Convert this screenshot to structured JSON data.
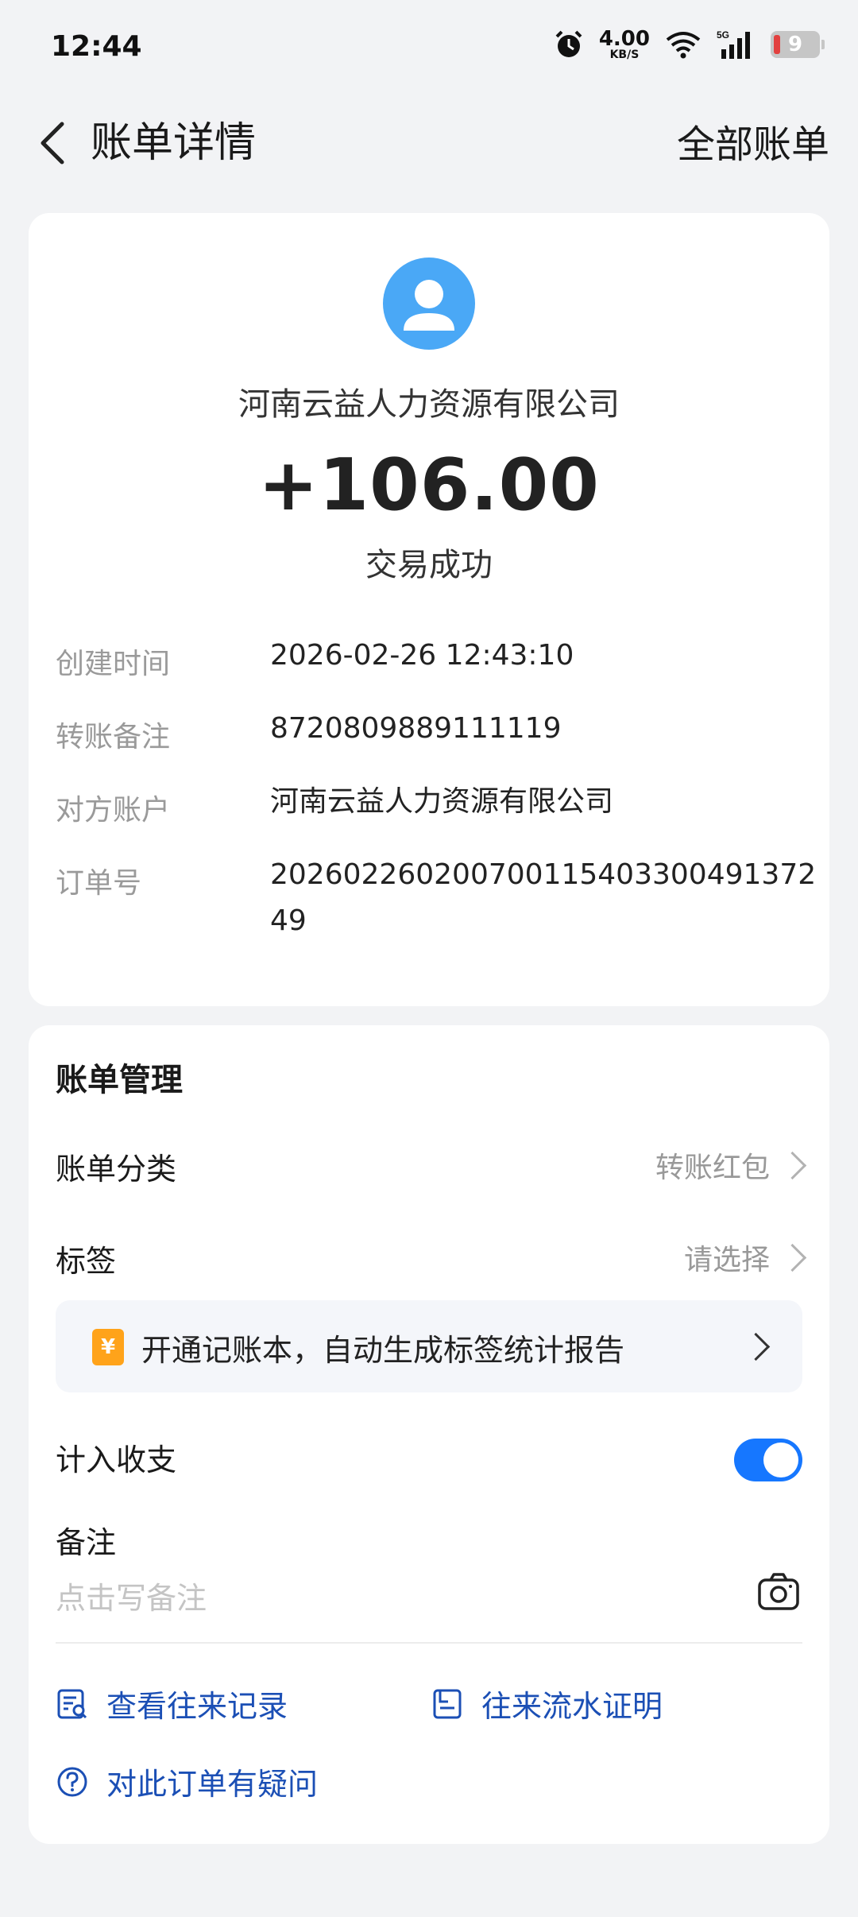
{
  "status_bar": {
    "time": "12:44",
    "speed_value": "4.00",
    "speed_unit": "KB/S",
    "network": "5G",
    "battery": "9"
  },
  "nav": {
    "title": "账单详情",
    "right_link": "全部账单"
  },
  "transaction": {
    "payee": "河南云益人力资源有限公司",
    "amount": "+106.00",
    "status": "交易成功",
    "details": [
      {
        "label": "创建时间",
        "value": "2026-02-26 12:43:10"
      },
      {
        "label": "转账备注",
        "value": "8720809889111119"
      },
      {
        "label": "对方账户",
        "value": "河南云益人力资源有限公司"
      },
      {
        "label": "订单号",
        "value": "20260226020070011540330049137249"
      }
    ]
  },
  "management": {
    "title": "账单管理",
    "category_label": "账单分类",
    "category_value": "转账红包",
    "tag_label": "标签",
    "tag_value": "请选择",
    "promo_text": "开通记账本，自动生成标签统计报告",
    "promo_icon": "¥",
    "include_label": "计入收支",
    "include_on": true,
    "note_label": "备注",
    "note_placeholder": "点击写备注",
    "links": {
      "history": "查看往来记录",
      "proof": "往来流水证明",
      "question": "对此订单有疑问"
    }
  },
  "colors": {
    "accent": "#1677ff",
    "link": "#1b4fb5",
    "avatar": "#4aa8f6",
    "promo_icon": "#ffa31a"
  }
}
